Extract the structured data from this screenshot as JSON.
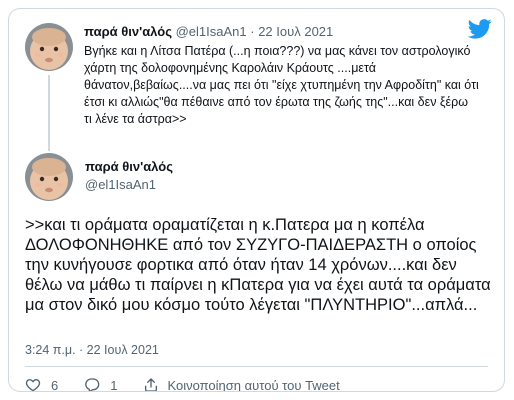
{
  "parent_tweet": {
    "display_name": "παρά θιν'αλός",
    "handle": "@el1IsaAn1",
    "separator": "·",
    "date": "22 Ιουλ 2021",
    "text": "Βγήκε και η Λίτσα Πατέρα (...η ποια???) να μας κάνει τον αστρολογικό χάρτη της δολοφονημένης Καρολάιν Κράουτς ....μετά θάνατον,βεβαίως....να μας πει ότι \"είχε χτυπημένη την Αφροδίτη\" και ότι έτσι κι αλλιώς\"θα πέθαινε από τον έρωτα της ζωής της\"...και δεν ξέρω τι λένε τα άστρα>>"
  },
  "tweet": {
    "display_name": "παρά θιν'αλός",
    "handle": "@el1IsaAn1",
    "text": ">>και τι οράματα οραματίζεται η κ.Πατερα μα  η κοπέλα ΔΟΛΟΦΟΝΗΘΗΚΕ από τον ΣΥΖΥΓΟ-ΠΑΙΔΕΡΑΣΤΗ ο οποίος την κυνήγουσε φορτικα από όταν ήταν 14 χρόνων....και δεν θέλω να μάθω τι παίρνει η κΠατερα για να έχει αυτά τα οράματα μα στον δικό μου κόσμο τούτο λέγεται \"ΠΛΥΝΤΗΡΙΟ\"...απλά...",
    "timestamp": "3:24 π.μ. · 22 Ιουλ 2021"
  },
  "actions": {
    "likes": "6",
    "replies": "1",
    "share_label": "Κοινοποίηση αυτού του Tweet"
  },
  "colors": {
    "twitter_blue": "#1d9bf0",
    "muted": "#536471",
    "border": "#cfd9de"
  },
  "icons": [
    "twitter-bird-icon",
    "heart-icon",
    "reply-icon",
    "share-icon"
  ]
}
